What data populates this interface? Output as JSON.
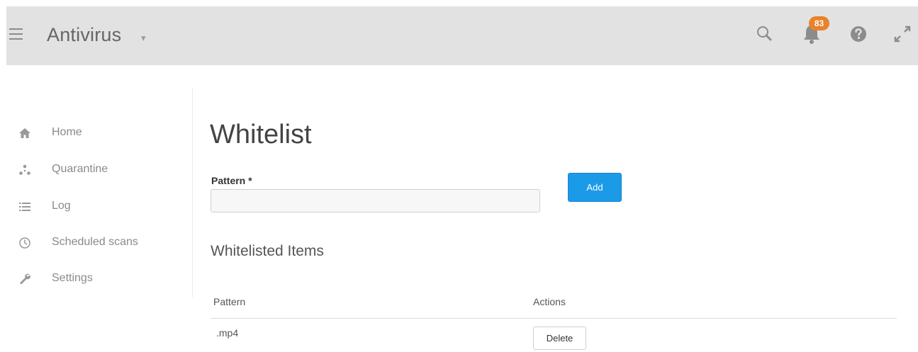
{
  "header": {
    "app_title": "Antivirus",
    "caret": "▾",
    "notification_count": "83",
    "accent_badge": "#e8822b"
  },
  "sidebar": {
    "items": [
      {
        "label": "Home",
        "icon": "home-icon"
      },
      {
        "label": "Quarantine",
        "icon": "quarantine-icon"
      },
      {
        "label": "Log",
        "icon": "list-icon"
      },
      {
        "label": "Scheduled scans",
        "icon": "clock-icon"
      },
      {
        "label": "Settings",
        "icon": "wrench-icon"
      }
    ]
  },
  "main": {
    "page_title": "Whitelist",
    "pattern_label": "Pattern *",
    "pattern_value": "",
    "add_label": "Add",
    "section_title": "Whitelisted Items",
    "table": {
      "columns": [
        "Pattern",
        "Actions"
      ],
      "rows": [
        {
          "pattern": ".mp4",
          "action_label": "Delete"
        }
      ]
    }
  },
  "colors": {
    "primary_button": "#1b9ae8",
    "topbar": "#e2e2e2"
  }
}
